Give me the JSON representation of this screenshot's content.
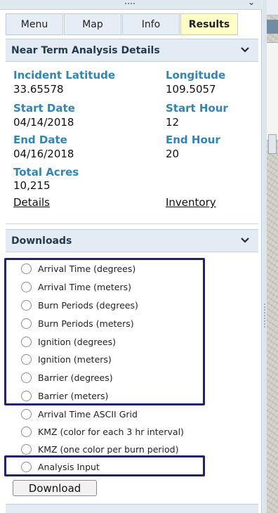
{
  "tabs": [
    {
      "label": "Menu"
    },
    {
      "label": "Map"
    },
    {
      "label": "Info"
    },
    {
      "label": "Results",
      "active": true
    }
  ],
  "details": {
    "title": "Near Term Analysis Details",
    "incident_latitude_label": "Incident Latitude",
    "incident_latitude": "33.65578",
    "longitude_label": "Longitude",
    "longitude": "109.5057",
    "start_date_label": "Start Date",
    "start_date": "04/14/2018",
    "start_hour_label": "Start Hour",
    "start_hour": "12",
    "end_date_label": "End Date",
    "end_date": "04/16/2018",
    "end_hour_label": "End Hour",
    "end_hour": "20",
    "total_acres_label": "Total Acres",
    "total_acres": "10,215",
    "details_link": "Details",
    "inventory_link": "Inventory"
  },
  "downloads": {
    "title": "Downloads",
    "options": [
      {
        "label": "Arrival Time (degrees)"
      },
      {
        "label": "Arrival Time (meters)"
      },
      {
        "label": "Burn Periods (degrees)"
      },
      {
        "label": "Burn Periods (meters)"
      },
      {
        "label": "Ignition (degrees)"
      },
      {
        "label": "Ignition (meters)"
      },
      {
        "label": "Barrier (degrees)"
      },
      {
        "label": "Barrier (meters)"
      },
      {
        "label": "Arrival Time ASCII Grid"
      },
      {
        "label": "KMZ (color for each 3 hr interval)"
      },
      {
        "label": "KMZ (one color per burn period)"
      },
      {
        "label": "Analysis Input"
      }
    ],
    "download_button": "Download"
  },
  "colors": {
    "label_blue": "#2f86b6",
    "active_tab": "#ffffc6",
    "highlight_box": "#22236a",
    "section_header": "#e3ebf4"
  },
  "icons": {
    "section_toggle": "chevron-down-icon",
    "radio": "radio-unchecked-icon"
  }
}
